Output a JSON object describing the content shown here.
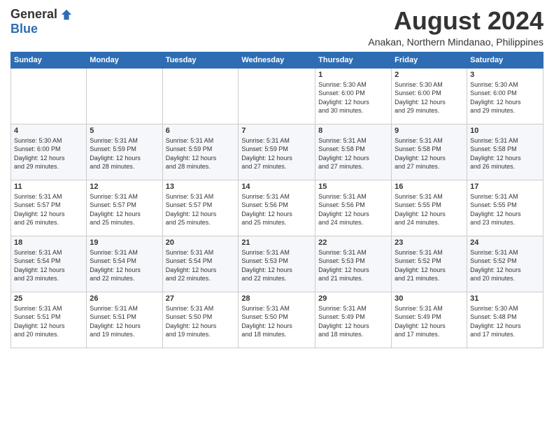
{
  "logo": {
    "general": "General",
    "blue": "Blue"
  },
  "title": {
    "month_year": "August 2024",
    "location": "Anakan, Northern Mindanao, Philippines"
  },
  "headers": [
    "Sunday",
    "Monday",
    "Tuesday",
    "Wednesday",
    "Thursday",
    "Friday",
    "Saturday"
  ],
  "weeks": [
    [
      {
        "day": "",
        "detail": ""
      },
      {
        "day": "",
        "detail": ""
      },
      {
        "day": "",
        "detail": ""
      },
      {
        "day": "",
        "detail": ""
      },
      {
        "day": "1",
        "detail": "Sunrise: 5:30 AM\nSunset: 6:00 PM\nDaylight: 12 hours\nand 30 minutes."
      },
      {
        "day": "2",
        "detail": "Sunrise: 5:30 AM\nSunset: 6:00 PM\nDaylight: 12 hours\nand 29 minutes."
      },
      {
        "day": "3",
        "detail": "Sunrise: 5:30 AM\nSunset: 6:00 PM\nDaylight: 12 hours\nand 29 minutes."
      }
    ],
    [
      {
        "day": "4",
        "detail": "Sunrise: 5:30 AM\nSunset: 6:00 PM\nDaylight: 12 hours\nand 29 minutes."
      },
      {
        "day": "5",
        "detail": "Sunrise: 5:31 AM\nSunset: 5:59 PM\nDaylight: 12 hours\nand 28 minutes."
      },
      {
        "day": "6",
        "detail": "Sunrise: 5:31 AM\nSunset: 5:59 PM\nDaylight: 12 hours\nand 28 minutes."
      },
      {
        "day": "7",
        "detail": "Sunrise: 5:31 AM\nSunset: 5:59 PM\nDaylight: 12 hours\nand 27 minutes."
      },
      {
        "day": "8",
        "detail": "Sunrise: 5:31 AM\nSunset: 5:58 PM\nDaylight: 12 hours\nand 27 minutes."
      },
      {
        "day": "9",
        "detail": "Sunrise: 5:31 AM\nSunset: 5:58 PM\nDaylight: 12 hours\nand 27 minutes."
      },
      {
        "day": "10",
        "detail": "Sunrise: 5:31 AM\nSunset: 5:58 PM\nDaylight: 12 hours\nand 26 minutes."
      }
    ],
    [
      {
        "day": "11",
        "detail": "Sunrise: 5:31 AM\nSunset: 5:57 PM\nDaylight: 12 hours\nand 26 minutes."
      },
      {
        "day": "12",
        "detail": "Sunrise: 5:31 AM\nSunset: 5:57 PM\nDaylight: 12 hours\nand 25 minutes."
      },
      {
        "day": "13",
        "detail": "Sunrise: 5:31 AM\nSunset: 5:57 PM\nDaylight: 12 hours\nand 25 minutes."
      },
      {
        "day": "14",
        "detail": "Sunrise: 5:31 AM\nSunset: 5:56 PM\nDaylight: 12 hours\nand 25 minutes."
      },
      {
        "day": "15",
        "detail": "Sunrise: 5:31 AM\nSunset: 5:56 PM\nDaylight: 12 hours\nand 24 minutes."
      },
      {
        "day": "16",
        "detail": "Sunrise: 5:31 AM\nSunset: 5:55 PM\nDaylight: 12 hours\nand 24 minutes."
      },
      {
        "day": "17",
        "detail": "Sunrise: 5:31 AM\nSunset: 5:55 PM\nDaylight: 12 hours\nand 23 minutes."
      }
    ],
    [
      {
        "day": "18",
        "detail": "Sunrise: 5:31 AM\nSunset: 5:54 PM\nDaylight: 12 hours\nand 23 minutes."
      },
      {
        "day": "19",
        "detail": "Sunrise: 5:31 AM\nSunset: 5:54 PM\nDaylight: 12 hours\nand 22 minutes."
      },
      {
        "day": "20",
        "detail": "Sunrise: 5:31 AM\nSunset: 5:54 PM\nDaylight: 12 hours\nand 22 minutes."
      },
      {
        "day": "21",
        "detail": "Sunrise: 5:31 AM\nSunset: 5:53 PM\nDaylight: 12 hours\nand 22 minutes."
      },
      {
        "day": "22",
        "detail": "Sunrise: 5:31 AM\nSunset: 5:53 PM\nDaylight: 12 hours\nand 21 minutes."
      },
      {
        "day": "23",
        "detail": "Sunrise: 5:31 AM\nSunset: 5:52 PM\nDaylight: 12 hours\nand 21 minutes."
      },
      {
        "day": "24",
        "detail": "Sunrise: 5:31 AM\nSunset: 5:52 PM\nDaylight: 12 hours\nand 20 minutes."
      }
    ],
    [
      {
        "day": "25",
        "detail": "Sunrise: 5:31 AM\nSunset: 5:51 PM\nDaylight: 12 hours\nand 20 minutes."
      },
      {
        "day": "26",
        "detail": "Sunrise: 5:31 AM\nSunset: 5:51 PM\nDaylight: 12 hours\nand 19 minutes."
      },
      {
        "day": "27",
        "detail": "Sunrise: 5:31 AM\nSunset: 5:50 PM\nDaylight: 12 hours\nand 19 minutes."
      },
      {
        "day": "28",
        "detail": "Sunrise: 5:31 AM\nSunset: 5:50 PM\nDaylight: 12 hours\nand 18 minutes."
      },
      {
        "day": "29",
        "detail": "Sunrise: 5:31 AM\nSunset: 5:49 PM\nDaylight: 12 hours\nand 18 minutes."
      },
      {
        "day": "30",
        "detail": "Sunrise: 5:31 AM\nSunset: 5:49 PM\nDaylight: 12 hours\nand 17 minutes."
      },
      {
        "day": "31",
        "detail": "Sunrise: 5:30 AM\nSunset: 5:48 PM\nDaylight: 12 hours\nand 17 minutes."
      }
    ]
  ]
}
